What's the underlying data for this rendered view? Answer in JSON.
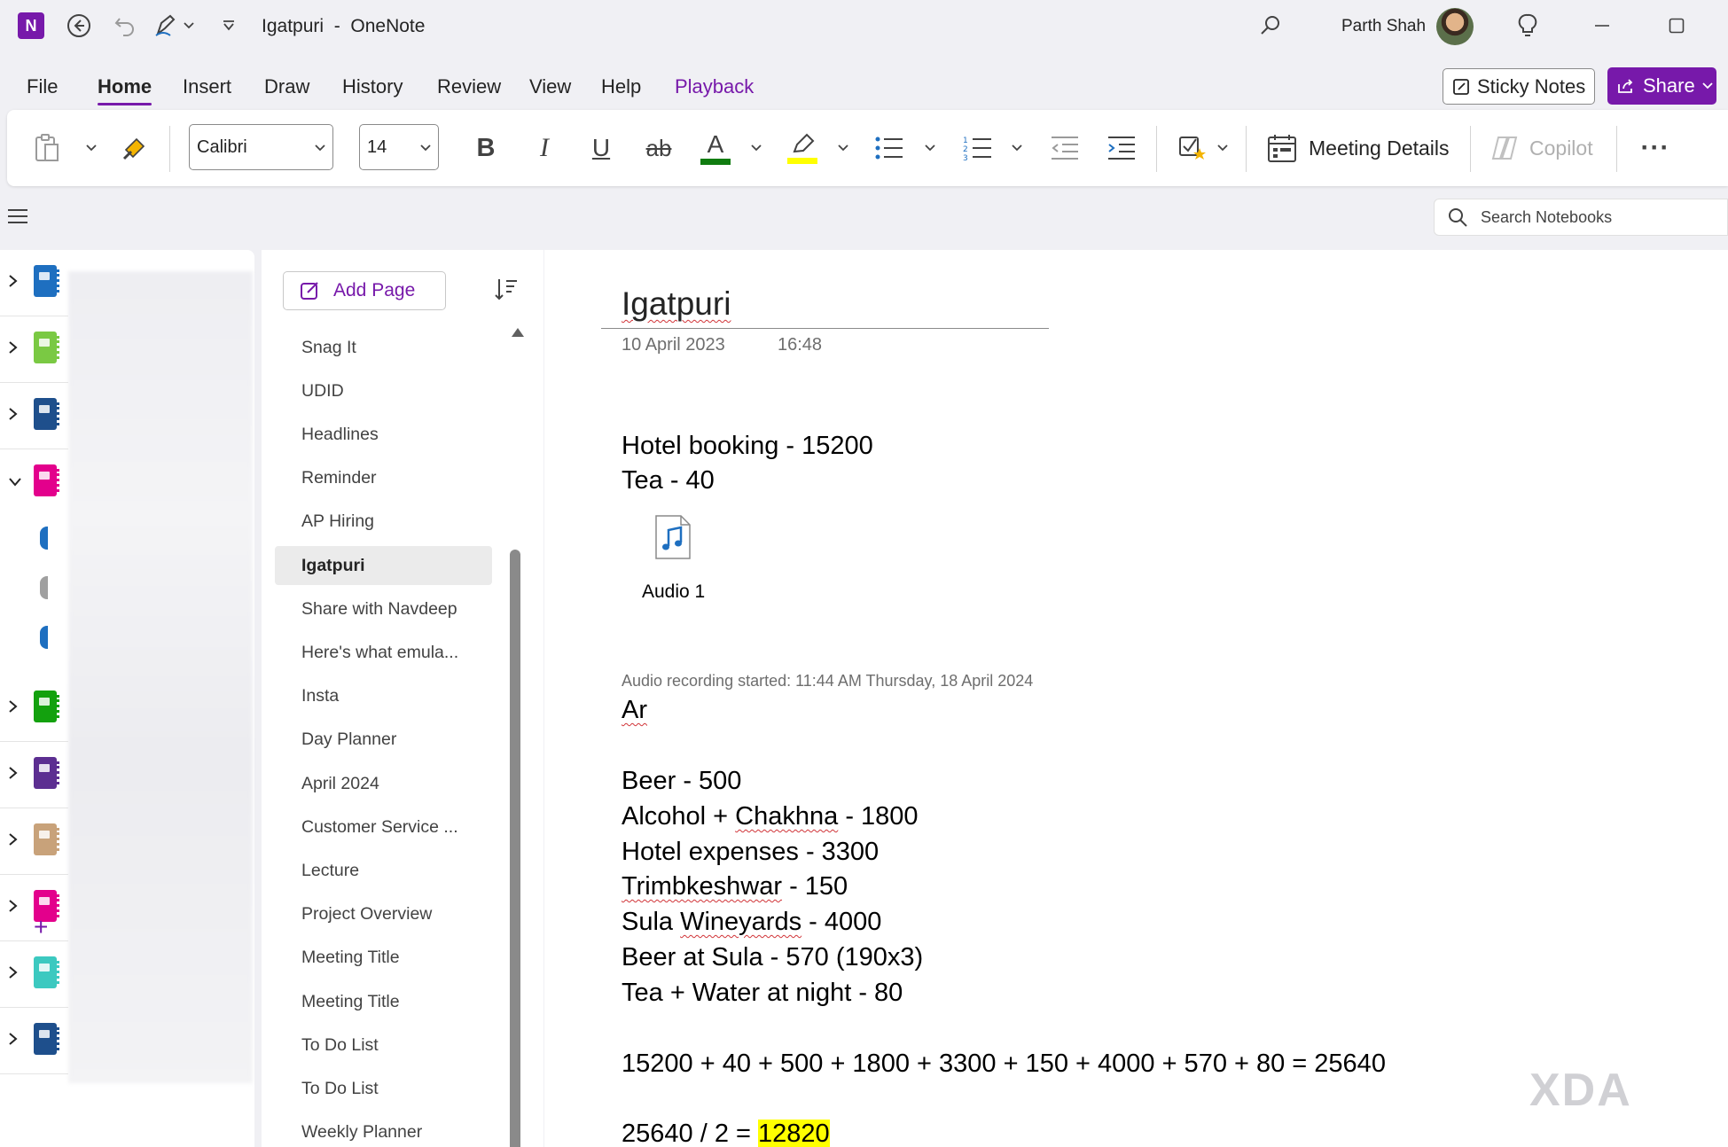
{
  "titlebar": {
    "app_icon_letter": "N",
    "title": "Igatpuri  -  OneNote",
    "user_name": "Parth Shah"
  },
  "ribbon": {
    "tabs": [
      "File",
      "Home",
      "Insert",
      "Draw",
      "History",
      "Review",
      "View",
      "Help",
      "Playback"
    ],
    "active_tab": "Home",
    "sticky_notes_label": "Sticky Notes",
    "share_label": "Share"
  },
  "toolbar": {
    "font_name": "Calibri",
    "font_size": "14",
    "bold_glyph": "B",
    "italic_glyph": "I",
    "underline_glyph": "U",
    "strike_glyph": "ab",
    "font_color_glyph": "A",
    "meeting_details_label": "Meeting Details",
    "copilot_label": "Copilot",
    "more_glyph": "···",
    "font_color": "#107c10",
    "highlight_color": "#ffff00"
  },
  "search": {
    "placeholder": "Search Notebooks"
  },
  "notebooks": {
    "colors": [
      "#1e6fc0",
      "#7ac943",
      "#1e4f8c",
      "#e3008c",
      "#13a10e",
      "#5c2e91",
      "#c8a27a",
      "#e3008c",
      "#3cc9c0",
      "#1e4f8c"
    ],
    "expanded_index": 3,
    "section_colors": [
      "#1e6fc0",
      "#a0a0a0",
      "#1e6fc0"
    ],
    "add_section_glyph": "+"
  },
  "page_list": {
    "add_page_label": "Add Page",
    "pages": [
      "Snag It",
      "UDID",
      "Headlines",
      "Reminder",
      "AP Hiring",
      "Igatpuri",
      "Share with Navdeep",
      "Here's what emula...",
      "Insta",
      "Day Planner",
      "April 2024",
      "Customer Service ...",
      "Lecture",
      "Project Overview",
      "Meeting Title",
      "Meeting Title",
      "To Do List",
      "To Do List",
      "Weekly Planner"
    ],
    "selected": "Igatpuri"
  },
  "note": {
    "title": "Igatpuri",
    "date": "10 April 2023",
    "time": "16:48",
    "line1": "Hotel booking - 15200",
    "line2": "Tea - 40",
    "audio_label": "Audio 1",
    "recording_meta": "Audio recording started: 11:44 AM Thursday, 18 April 2024",
    "ar": "Ar",
    "expenses": {
      "beer": "Beer - 500",
      "alcohol_pre": "Alcohol + ",
      "alcohol_word": "Chakhna",
      "alcohol_post": " - 1800",
      "hotel": "Hotel expenses - 3300",
      "trimb_word": "Trimbkeshwar",
      "trimb_post": " - 150",
      "sula_pre": "Sula ",
      "sula_word": "Wineyards",
      "sula_post": " - 4000",
      "beer_sula": "Beer at Sula - 570 (190x3)",
      "tea_water": "Tea + Water at night - 80"
    },
    "sum_line": "15200 + 40 + 500 + 1800 + 3300 + 150 + 4000 + 570 + 80 = 25640",
    "div_prefix": "25640 / 2 = ",
    "div_result": "12820"
  },
  "watermark": "XDA"
}
